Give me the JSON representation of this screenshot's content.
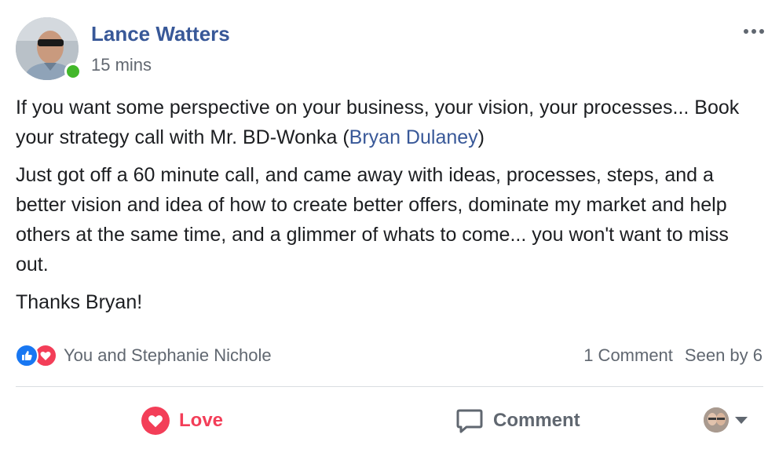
{
  "post": {
    "author": "Lance Watters",
    "timestamp": "15 mins",
    "paragraphs": [
      {
        "before": "If you want some perspective on your business, your vision, your processes... Book your strategy call with Mr. BD-Wonka (",
        "mention": "Bryan Dulaney",
        "after": ")"
      },
      {
        "text": "Just got off a 60 minute call, and came away with ideas, processes, steps, and a better vision and idea of how to create better offers, dominate my market and help others at the same time, and a glimmer of whats to come... you won't want to miss out."
      },
      {
        "text": "Thanks Bryan!"
      }
    ]
  },
  "reactions": {
    "icons": [
      "like-icon",
      "love-icon"
    ],
    "names": "You and Stephanie Nichole"
  },
  "stats": {
    "comments": "1 Comment",
    "seen": "Seen by 6"
  },
  "actions": {
    "love_label": "Love",
    "comment_label": "Comment"
  },
  "colors": {
    "author_link": "#385898",
    "love": "#f33e58",
    "like": "#1877f2",
    "online": "#42b72a",
    "secondary_text": "#606770"
  }
}
